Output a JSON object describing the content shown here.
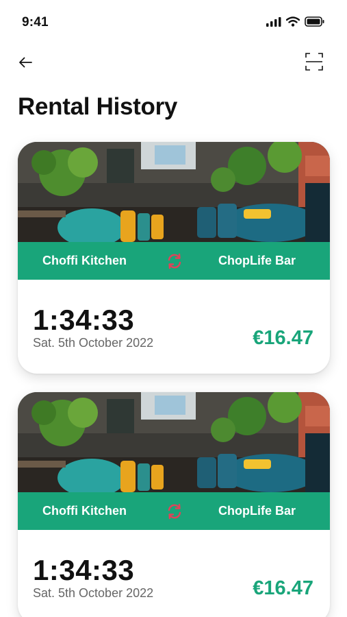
{
  "status_bar": {
    "time": "9:41"
  },
  "header": {
    "title": "Rental History"
  },
  "colors": {
    "accent": "#19a57a",
    "swap_icon": "#e0435a",
    "text_primary": "#111111",
    "text_secondary": "#666666"
  },
  "rentals": [
    {
      "from": "Choffi Kitchen",
      "to": "ChopLife Bar",
      "duration": "1:34:33",
      "date": "Sat. 5th October 2022",
      "price": "€16.47",
      "photo": "restaurant-interior-photo"
    },
    {
      "from": "Choffi Kitchen",
      "to": "ChopLife Bar",
      "duration": "1:34:33",
      "date": "Sat. 5th October 2022",
      "price": "€16.47",
      "photo": "restaurant-interior-photo"
    }
  ]
}
